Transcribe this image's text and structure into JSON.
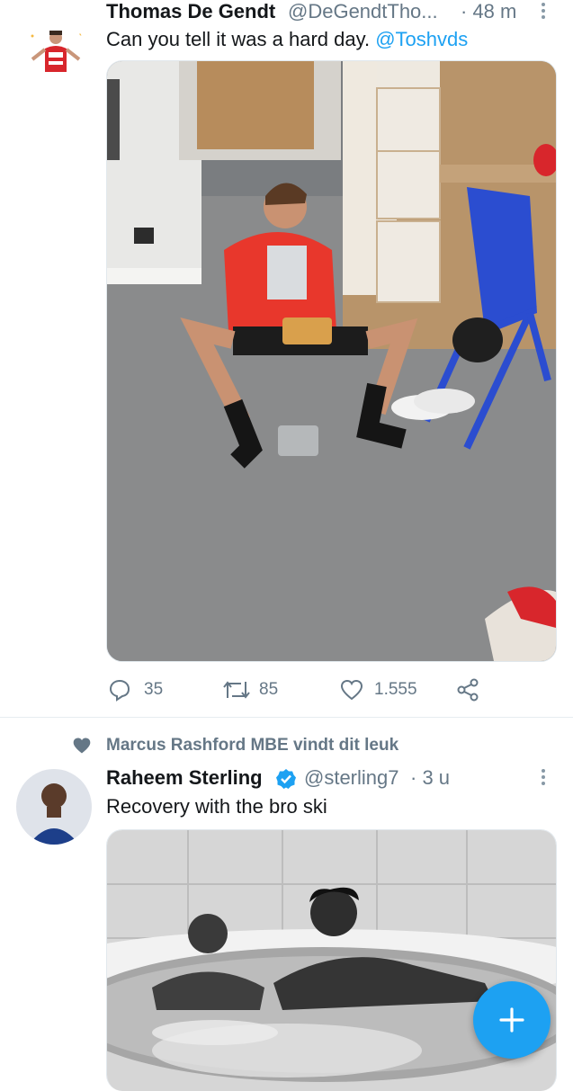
{
  "tweets": [
    {
      "name": "Thomas De Gendt",
      "handle": "@DeGendtTho...",
      "time": "· 48 m",
      "text_prefix": "Can you tell it was a hard day. ",
      "text_mention": "@Toshvds",
      "image_label": "photo",
      "actions": {
        "replies": "35",
        "retweets": "85",
        "likes": "1.555"
      }
    },
    {
      "social_context": "Marcus Rashford MBE vindt dit leuk",
      "name": "Raheem Sterling",
      "handle": "@sterling7",
      "time": "· 3 u",
      "verified": true,
      "text": "Recovery with the bro ski",
      "image_label": "photo"
    }
  ],
  "icons": [
    "more-icon",
    "reply-icon",
    "retweet-icon",
    "like-icon",
    "share-icon",
    "heart-filled-icon",
    "verified-icon",
    "plus-icon"
  ],
  "colors": {
    "accent": "#1da1f2",
    "muted": "#657786",
    "text": "#14171a"
  }
}
